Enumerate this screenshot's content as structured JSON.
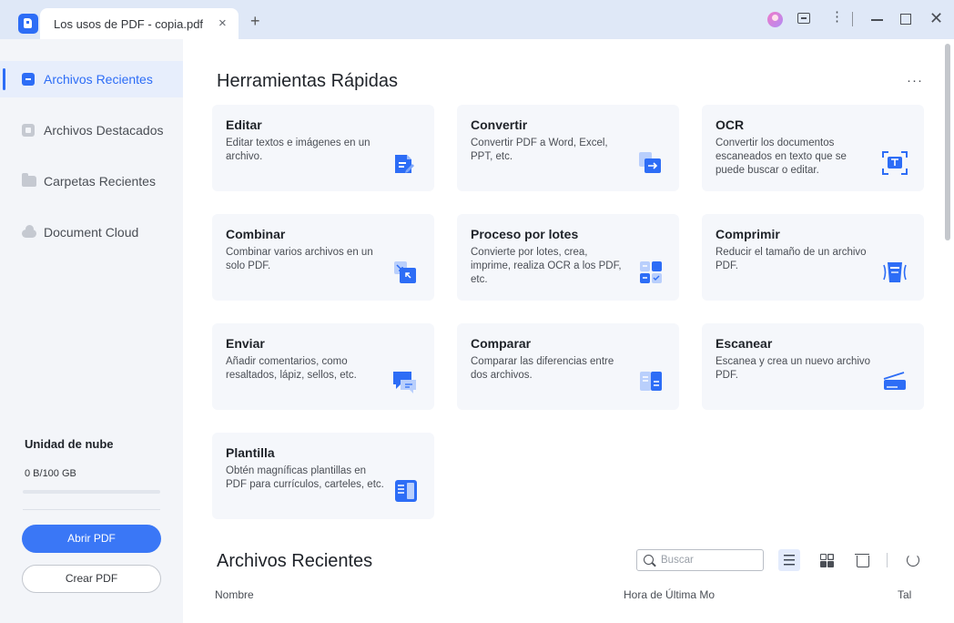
{
  "titlebar": {
    "tab_title": "Los usos de PDF - copia.pdf",
    "tab_close": "×",
    "new_tab": "+",
    "more": "⋮",
    "close": "✕"
  },
  "sidebar": {
    "items": [
      {
        "label": "Archivos Recientes",
        "icon": "recent-files-icon",
        "active": true
      },
      {
        "label": "Archivos Destacados",
        "icon": "star-icon",
        "active": false
      },
      {
        "label": "Carpetas Recientes",
        "icon": "folder-icon",
        "active": false
      },
      {
        "label": "Document Cloud",
        "icon": "cloud-icon",
        "active": false
      }
    ],
    "cloud_title": "Unidad de nube",
    "cloud_usage": "0 B/100 GB",
    "cloud_usage_fraction": 0,
    "open_pdf": "Abrir PDF",
    "create_pdf": "Crear PDF"
  },
  "quick_tools": {
    "title": "Herramientas Rápidas",
    "more": "···",
    "cards": [
      {
        "title": "Editar",
        "desc": "Editar textos e imágenes en un archivo.",
        "icon": "edit-icon"
      },
      {
        "title": "Convertir",
        "desc": "Convertir PDF a Word, Excel, PPT, etc.",
        "icon": "convert-icon"
      },
      {
        "title": "OCR",
        "desc": "Convertir los documentos escaneados en texto que se puede buscar o editar.",
        "icon": "ocr-icon"
      },
      {
        "title": "Combinar",
        "desc": "Combinar varios archivos en un solo PDF.",
        "icon": "combine-icon"
      },
      {
        "title": "Proceso por lotes",
        "desc": "Convierte por lotes, crea, imprime, realiza OCR a los PDF, etc.",
        "icon": "batch-icon"
      },
      {
        "title": "Comprimir",
        "desc": "Reducir el tamaño de un archivo PDF.",
        "icon": "compress-icon"
      },
      {
        "title": "Enviar",
        "desc": "Añadir comentarios, como resaltados, lápiz, sellos, etc.",
        "icon": "send-icon"
      },
      {
        "title": "Comparar",
        "desc": "Comparar las diferencias entre dos archivos.",
        "icon": "compare-icon"
      },
      {
        "title": "Escanear",
        "desc": "Escanea y crea un nuevo archivo PDF.",
        "icon": "scan-icon"
      },
      {
        "title": "Plantilla",
        "desc": "Obtén magníficas plantillas en PDF para currículos, carteles, etc.",
        "icon": "template-icon"
      }
    ]
  },
  "recent": {
    "title": "Archivos Recientes",
    "search_placeholder": "Buscar",
    "columns": [
      "Nombre",
      "Hora de Última Mo",
      "Tal"
    ]
  },
  "colors": {
    "accent": "#2d6df6",
    "titlebar_bg": "#dfe8f7",
    "sidebar_bg": "#f3f5f9",
    "card_bg": "#f5f7fb"
  }
}
